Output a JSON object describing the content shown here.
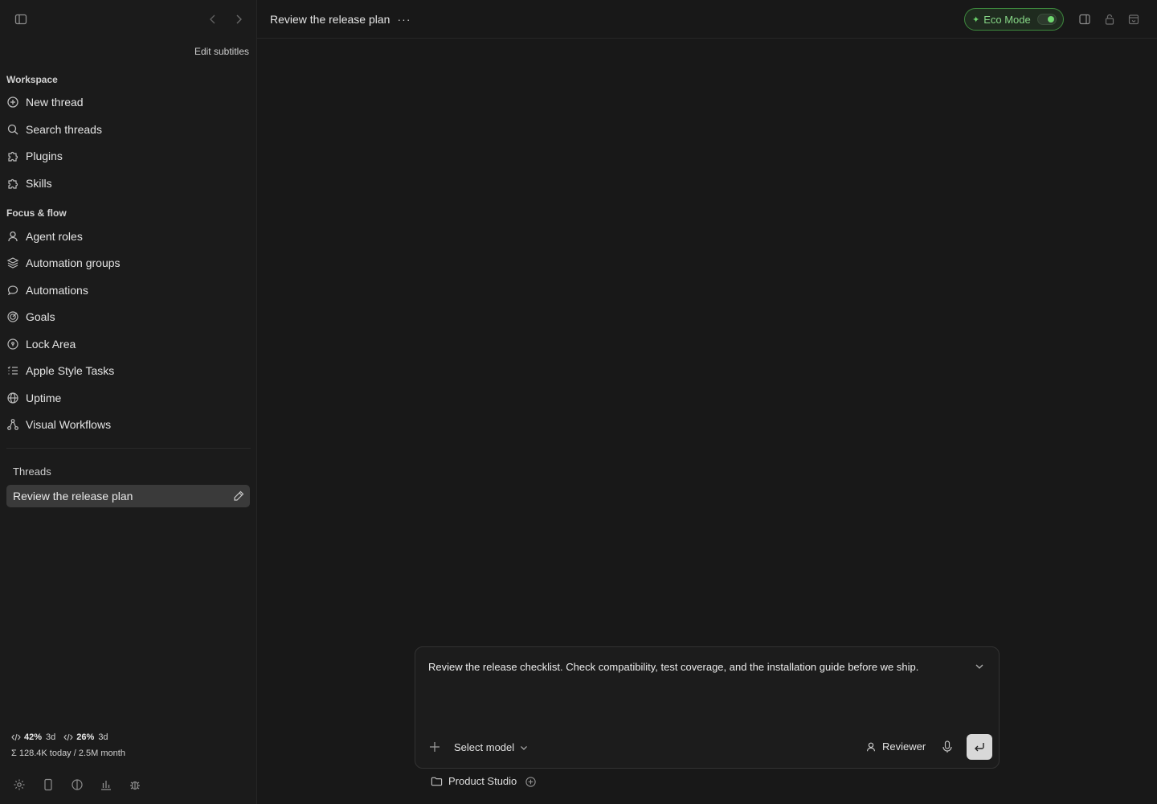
{
  "sidebar": {
    "edit_subtitles": "Edit subtitles",
    "workspace_label": "Workspace",
    "workspace_items": [
      {
        "label": "New thread",
        "icon": "plus-circle-icon"
      },
      {
        "label": "Search threads",
        "icon": "search-icon"
      },
      {
        "label": "Plugins",
        "icon": "puzzle-icon"
      },
      {
        "label": "Skills",
        "icon": "puzzle-icon"
      }
    ],
    "focus_label": "Focus & flow",
    "focus_items": [
      {
        "label": "Agent roles",
        "icon": "user-icon"
      },
      {
        "label": "Automation groups",
        "icon": "layers-icon"
      },
      {
        "label": "Automations",
        "icon": "chat-bubble-icon"
      },
      {
        "label": "Goals",
        "icon": "target-icon"
      },
      {
        "label": "Lock Area",
        "icon": "lock-circle-icon"
      },
      {
        "label": "Apple Style Tasks",
        "icon": "list-icon"
      },
      {
        "label": "Uptime",
        "icon": "globe-icon"
      },
      {
        "label": "Visual Workflows",
        "icon": "workflow-icon"
      }
    ],
    "threads_label": "Threads",
    "threads": [
      {
        "label": "Review the release plan"
      }
    ],
    "usage": {
      "metric1_pct": "42%",
      "metric1_period": "3d",
      "metric2_pct": "26%",
      "metric2_period": "3d",
      "tokens": "Σ 128.4K today / 2.5M month"
    }
  },
  "header": {
    "title": "Review the release plan",
    "more": "···",
    "eco_mode": "Eco Mode",
    "eco_mode_on": true,
    "accent_color": "#6bd16b"
  },
  "composer": {
    "prompt": "Review the release checklist. Check compatibility, test coverage, and the installation guide before we ship.",
    "model_label": "Select model",
    "agent_label": "Reviewer"
  },
  "project": {
    "label": "Product Studio"
  }
}
